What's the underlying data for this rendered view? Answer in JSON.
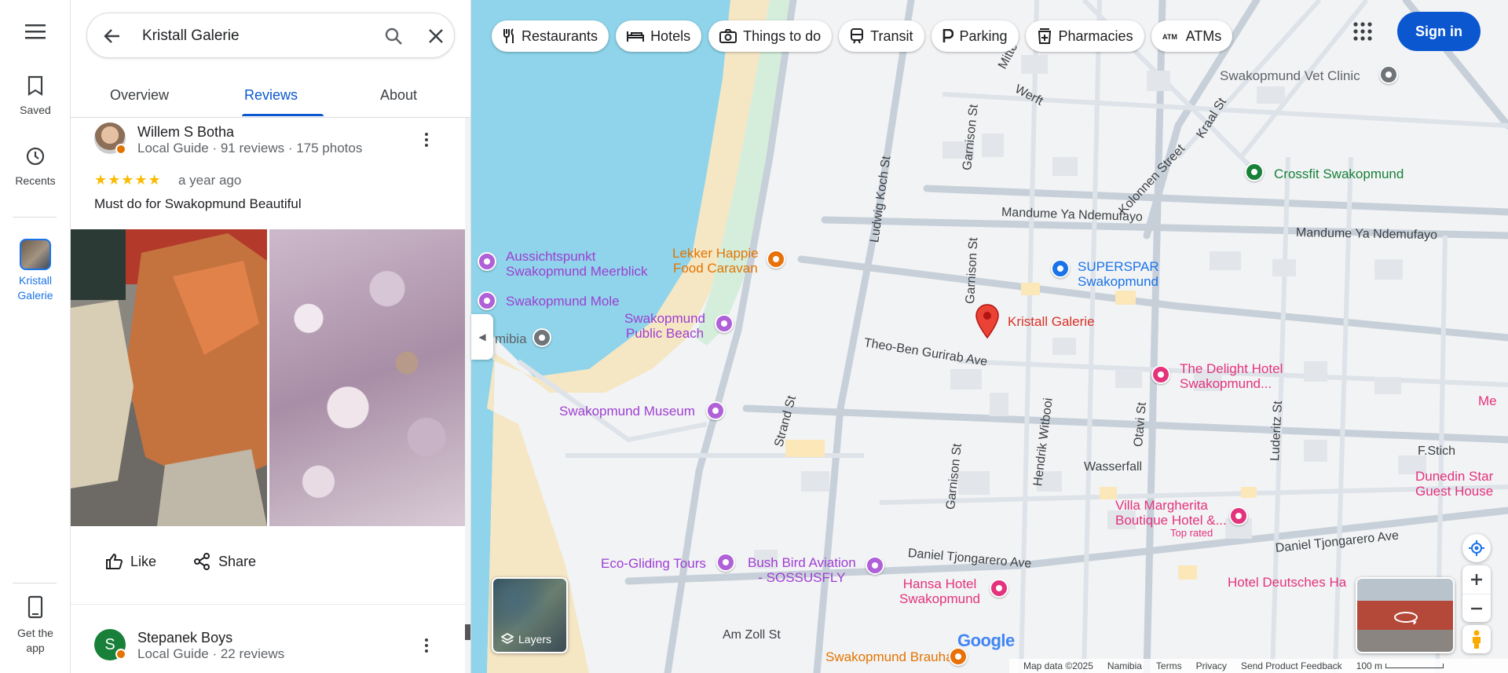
{
  "rail": {
    "saved": "Saved",
    "recents": "Recents",
    "place": "Kristall Galerie",
    "get_app": "Get the app"
  },
  "search": {
    "value": "Kristall Galerie"
  },
  "tabs": [
    {
      "label": "Overview"
    },
    {
      "label": "Reviews"
    },
    {
      "label": "About"
    }
  ],
  "reviews": [
    {
      "name": "Willem S Botha",
      "meta": "Local Guide · 91 reviews · 175 photos",
      "rating": 5,
      "stars": "★★★★★",
      "time": "a year ago",
      "text": "Must do for Swakopmund Beautiful"
    },
    {
      "initial": "S",
      "name": "Stepanek Boys",
      "meta": "Local Guide · 22 reviews"
    }
  ],
  "actions": {
    "like": "Like",
    "share": "Share"
  },
  "chips": [
    {
      "label": "Restaurants",
      "icon": "fork-knife-icon"
    },
    {
      "label": "Hotels",
      "icon": "bed-icon"
    },
    {
      "label": "Things to do",
      "icon": "camera-icon"
    },
    {
      "label": "Transit",
      "icon": "train-icon"
    },
    {
      "label": "Parking",
      "icon": "parking-icon"
    },
    {
      "label": "Pharmacies",
      "icon": "pharmacy-icon"
    },
    {
      "label": "ATMs",
      "icon": "atm-icon"
    }
  ],
  "header": {
    "signin": "Sign in"
  },
  "map": {
    "pois": {
      "aussichtspunkt": "Aussichtspunkt\nSwakopmund Meerblick",
      "mole": "Swakopmund Mole",
      "public_beach": "Swakopmund\nPublic Beach",
      "museum": "Swakopmund Museum",
      "lekker": "Lekker Happie\nFood Caravan",
      "namibia": "mibia",
      "superspar": "SUPERSPAR\nSwakopmund",
      "kristall": "Kristall Galerie",
      "delight": "The Delight Hotel\nSwakopmund...",
      "vet": "Swakopmund Vet Clinic",
      "crossfit": "Crossfit Swakopmund",
      "villa": "Villa Margherita\nBoutique Hotel &...",
      "top_rated": "Top rated",
      "dunedin": "Dunedin Star\nGuest House",
      "eco": "Eco-Gliding Tours",
      "bushbird": "Bush Bird Aviation\n- SOSSUSFLY",
      "hansa": "Hansa Hotel\nSwakopmund",
      "deutsches": "Hotel Deutsches Ha",
      "brauhaus": "Swakopmund Brauhaus",
      "me": "Me"
    },
    "streets": {
      "mandume1": "Mandume Ya Ndemufayo",
      "mandume2": "Mandume Ya Ndemufayo",
      "theoben": "Theo-Ben Gurirab Ave",
      "wasserfall": "Wasserfall",
      "daniel1": "Daniel Tjongarero Ave",
      "daniel2": "Daniel Tjongarero Ave",
      "amzoll": "Am Zoll St",
      "fstich": "F.Stich",
      "strand": "Strand St",
      "ludwig": "Ludwig Koch St",
      "garnison1": "Garnison St",
      "garnison2": "Garnison St",
      "garnison3": "Garnison St",
      "hendrik": "Hendrik Witbooi",
      "otavi": "Otavi St",
      "luderitz": "Luderitz St",
      "kolonnen": "Kolonnen Street",
      "kraal": "Kraal St",
      "werft": "Werft",
      "mitte": "Mitte"
    },
    "layers_label": "Layers",
    "google": "Google"
  },
  "footer": {
    "map_data": "Map data ©2025",
    "country": "Namibia",
    "terms": "Terms",
    "privacy": "Privacy",
    "feedback": "Send Product Feedback",
    "scale": "100 m"
  },
  "colors": {
    "accent": "#0b57d0",
    "water": "#8fd4ea",
    "sand": "#f5e6c4",
    "pin": "#ea4335"
  }
}
